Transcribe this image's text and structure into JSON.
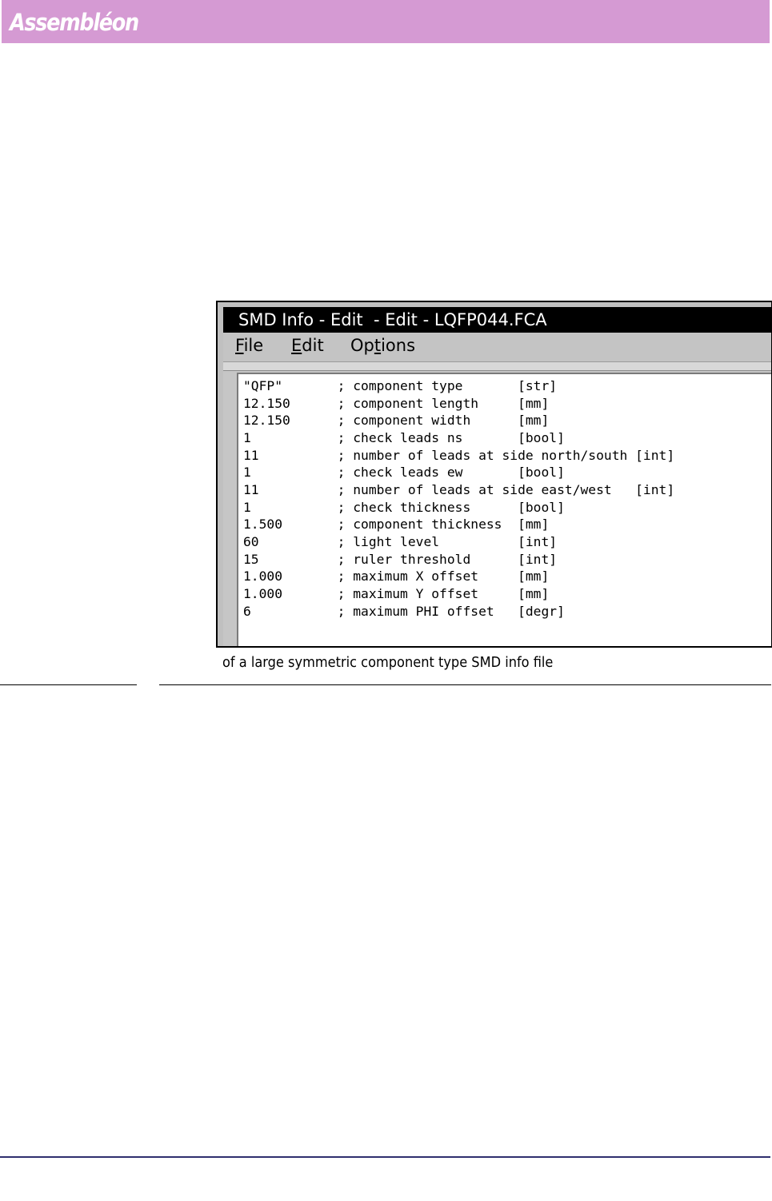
{
  "header": {
    "brand": "Assembléon",
    "band_color": "#d59ad3"
  },
  "window": {
    "title": "SMD Info - Edit  - Edit - LQFP044.FCA",
    "menu": {
      "file": {
        "accel": "F",
        "rest": "ile"
      },
      "edit": {
        "accel": "E",
        "rest": "dit"
      },
      "options": {
        "pre": "Op",
        "accel": "t",
        "rest": "ions"
      }
    },
    "lines": [
      "\"QFP\"       ; component type       [str]",
      "12.150      ; component length     [mm]",
      "12.150      ; component width      [mm]",
      "1           ; check leads ns       [bool]",
      "11          ; number of leads at side north/south [int]",
      "1           ; check leads ew       [bool]",
      "11          ; number of leads at side east/west   [int]",
      "1           ; check thickness      [bool]",
      "1.500       ; component thickness  [mm]",
      "60          ; light level          [int]",
      "15          ; ruler threshold      [int]",
      "1.000       ; maximum X offset     [mm]",
      "1.000       ; maximum Y offset     [mm]",
      "6           ; maximum PHI offset   [degr]"
    ]
  },
  "caption": "of a large symmetric component type SMD info file",
  "colors": {
    "footer_rule": "#2f2f6e",
    "window_chrome": "#c0c0c0",
    "title_bar": "#000000"
  }
}
